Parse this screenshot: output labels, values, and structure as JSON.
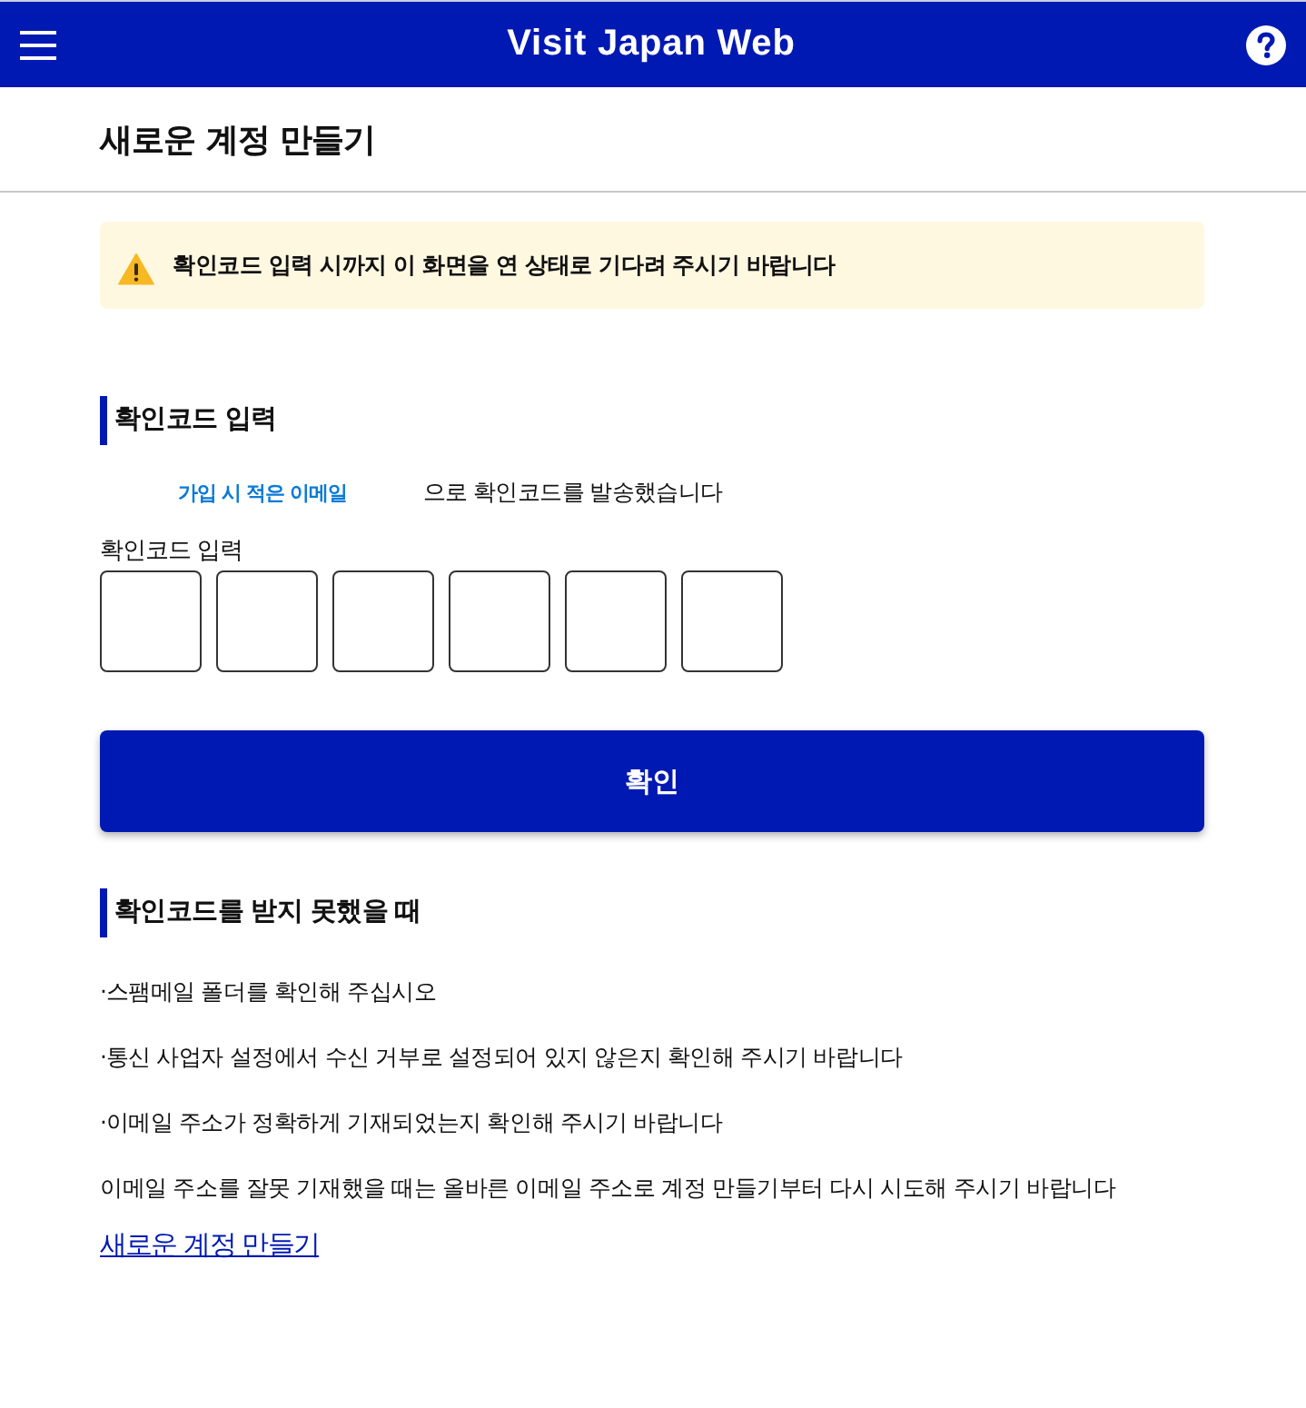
{
  "header": {
    "title": "Visit Japan Web"
  },
  "page_title": "새로운 계정 만들기",
  "notice": "확인코드 입력 시까지 이 화면을 연 상태로 기다려 주시기 바랍니다",
  "verify": {
    "heading": "확인코드 입력",
    "email": "가입 시 적은 이메일",
    "sent_text": "으로 확인코드를 발송했습니다",
    "code_label": "확인코드 입력",
    "code_cells": [
      {
        "kind": "digit"
      },
      {
        "kind": "digit"
      },
      {
        "kind": "digit"
      },
      {
        "kind": "digit"
      },
      {
        "kind": "digit"
      },
      {
        "kind": "digit"
      }
    ],
    "submit": "확인"
  },
  "help": {
    "heading": "확인코드를 받지 못했을 때",
    "tips": [
      "·스팸메일 폴더를 확인해 주십시오",
      "·통신 사업자 설정에서 수신 거부로 설정되어 있지 않은지 확인해 주시기 바랍니다",
      "·이메일 주소가 정확하게 기재되었는지 확인해 주시기 바랍니다"
    ],
    "note": "이메일 주소를 잘못 기재했을 때는 올바른 이메일 주소로 계정 만들기부터 다시 시도해 주시기 바랍니다",
    "link": "새로운 계정 만들기"
  }
}
